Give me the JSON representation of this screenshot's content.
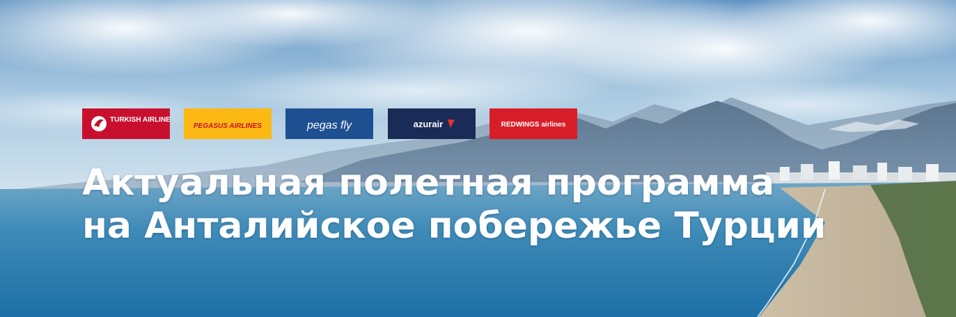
{
  "banner": {
    "headline_line1": "Актуальная полетная программа",
    "headline_line2": "на Анталийское побережье Турции",
    "scene": [
      "sky-with-clouds",
      "mountains",
      "sea",
      "beach",
      "city-coastline"
    ]
  },
  "airlines": [
    {
      "name": "TURKISH AIRLINES",
      "bg_color": "#c8102e",
      "icon": "turkish-airlines-logo"
    },
    {
      "name": "PEGASUS AIRLINES",
      "bg_color": "#fdb913",
      "icon": "pegasus-airlines-logo"
    },
    {
      "name": "pegas fly",
      "bg_color": "#1d4f91",
      "icon": "pegas-fly-logo"
    },
    {
      "name": "azurair",
      "bg_color": "#1b2b57",
      "icon": "azur-air-logo"
    },
    {
      "name": "REDWINGS airlines",
      "bg_color": "#d71e28",
      "icon": "red-wings-logo"
    }
  ]
}
